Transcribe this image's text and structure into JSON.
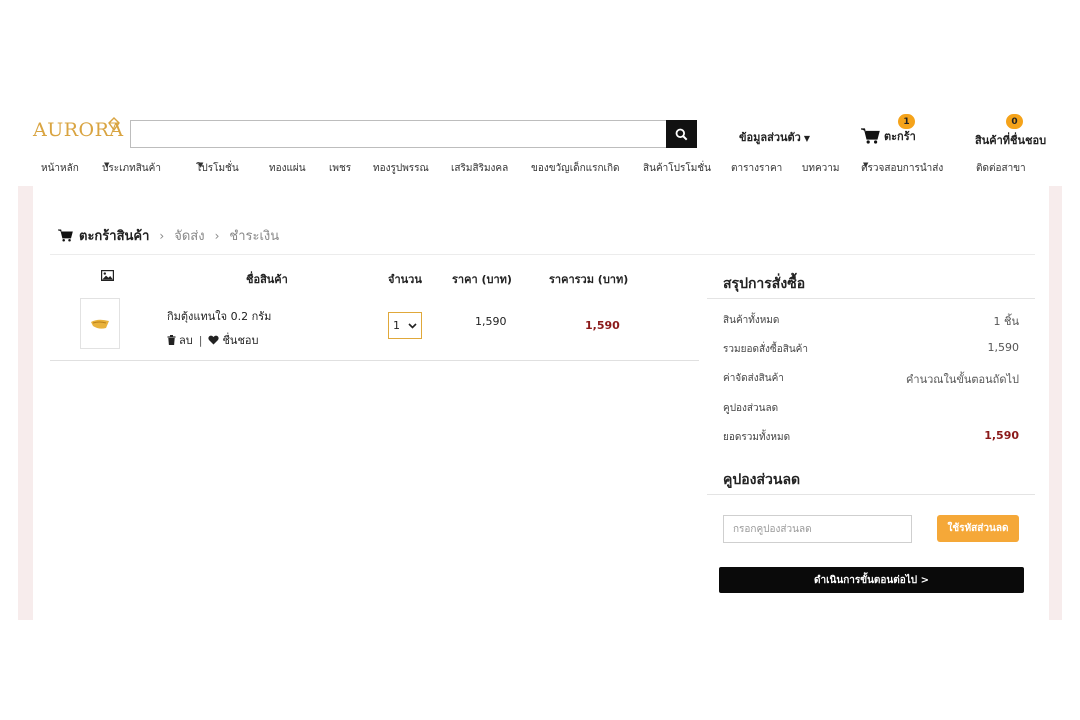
{
  "brand": {
    "logo_text": "AURORA",
    "accent": "#d9a441"
  },
  "header": {
    "search_placeholder": "",
    "account_label": "ข้อมูลส่วนตัว",
    "cart_label": "ตะกร้า",
    "cart_count": "1",
    "wishlist_label": "สินค้าที่ชื่นชอบ",
    "wishlist_count": "0"
  },
  "nav": {
    "items": [
      {
        "label": "หน้าหลัก"
      },
      {
        "label": "ประเภทสินค้า"
      },
      {
        "label": "โปรโมชั่น"
      },
      {
        "label": "ทองแผ่น"
      },
      {
        "label": "เพชร"
      },
      {
        "label": "ทองรูปพรรณ"
      },
      {
        "label": "เสริมสิริมงคล"
      },
      {
        "label": "ของขวัญเด็กแรกเกิด"
      },
      {
        "label": "สินค้าโปรโมชั่น"
      },
      {
        "label": "ตารางราคา"
      },
      {
        "label": "บทความ"
      },
      {
        "label": "ตรวจสอบการนำส่ง"
      },
      {
        "label": "ติดต่อสาขา"
      }
    ]
  },
  "breadcrumb": {
    "steps": [
      "ตะกร้าสินค้า",
      "จัดส่ง",
      "ชำระเงิน"
    ],
    "separator": "›"
  },
  "cart_table": {
    "headers": {
      "product": "ชื่อสินค้า",
      "quantity": "จำนวน",
      "price": "ราคา (บาท)",
      "total": "ราคารวม (บาท)"
    },
    "rows": [
      {
        "name": "กิมตุ้งแทนใจ 0.2 กรัม",
        "delete_label": "ลบ",
        "separator": "|",
        "wishlist_label": "ชื่นชอบ",
        "quantity": "1",
        "price": "1,590",
        "total": "1,590"
      }
    ]
  },
  "summary": {
    "title": "สรุปการสั่งซื้อ",
    "rows": [
      {
        "label": "สินค้าทั้งหมด",
        "value": "1 ชิ้น"
      },
      {
        "label": "รวมยอดสั่งซื้อสินค้า",
        "value": "1,590"
      },
      {
        "label": "ค่าจัดส่งสินค้า",
        "value": "คำนวณในขั้นตอนถัดไป"
      },
      {
        "label": "คูปองส่วนลด",
        "value": ""
      },
      {
        "label": "ยอดรวมทั้งหมด",
        "value": "1,590"
      }
    ],
    "highlight_color": "#8b1a1a"
  },
  "coupon": {
    "title": "คูปองส่วนลด",
    "placeholder": "กรอกคูปองส่วนลด",
    "button_label": "ใช้รหัสส่วนลด",
    "button_color": "#f5a838"
  },
  "proceed": {
    "label": "ดำเนินการขั้นตอนต่อไป >"
  }
}
